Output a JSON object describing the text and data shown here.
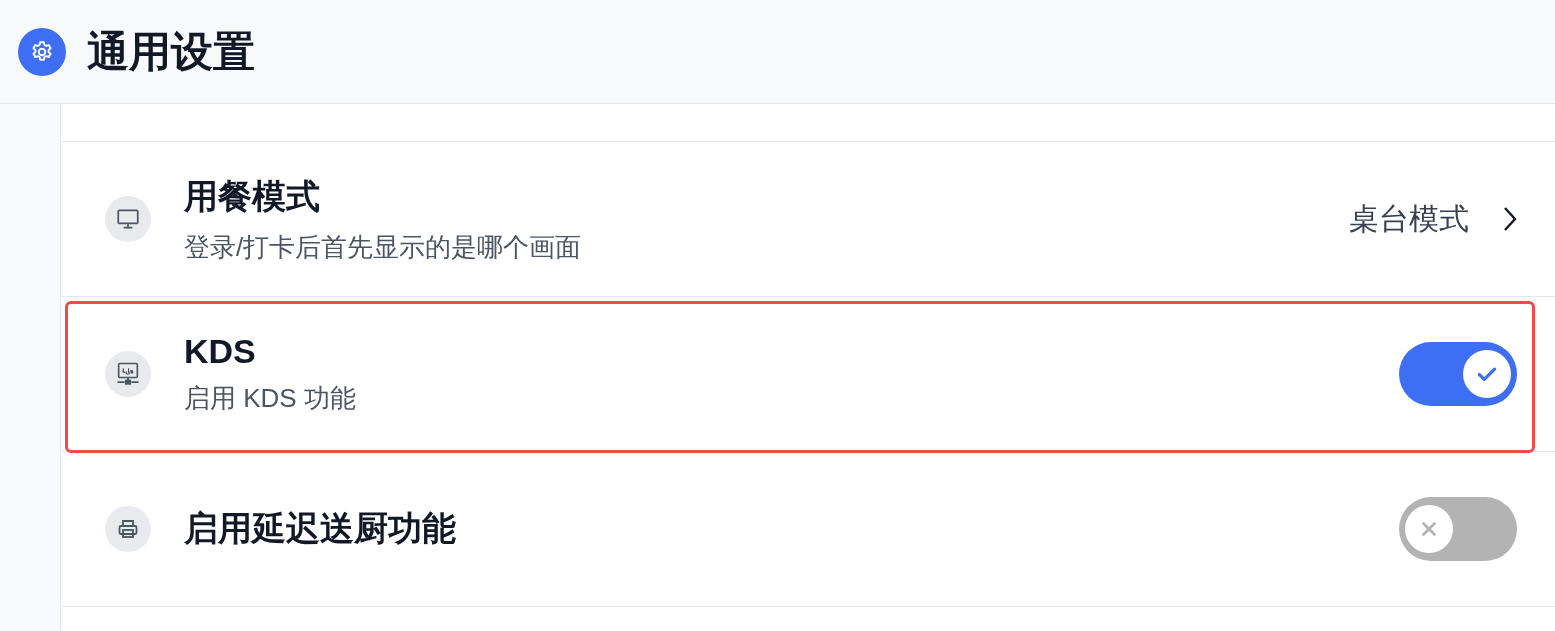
{
  "header": {
    "title": "通用设置"
  },
  "rows": [
    {
      "kind": "link",
      "title": "用餐模式",
      "subtitle": "登录/打卡后首先显示的是哪个画面",
      "value": "桌台模式",
      "highlighted": false
    },
    {
      "kind": "toggle",
      "title": "KDS",
      "subtitle": "启用 KDS 功能",
      "on": true,
      "highlighted": true
    },
    {
      "kind": "toggle",
      "title": "启用延迟送厨功能",
      "on": false,
      "highlighted": false
    }
  ]
}
